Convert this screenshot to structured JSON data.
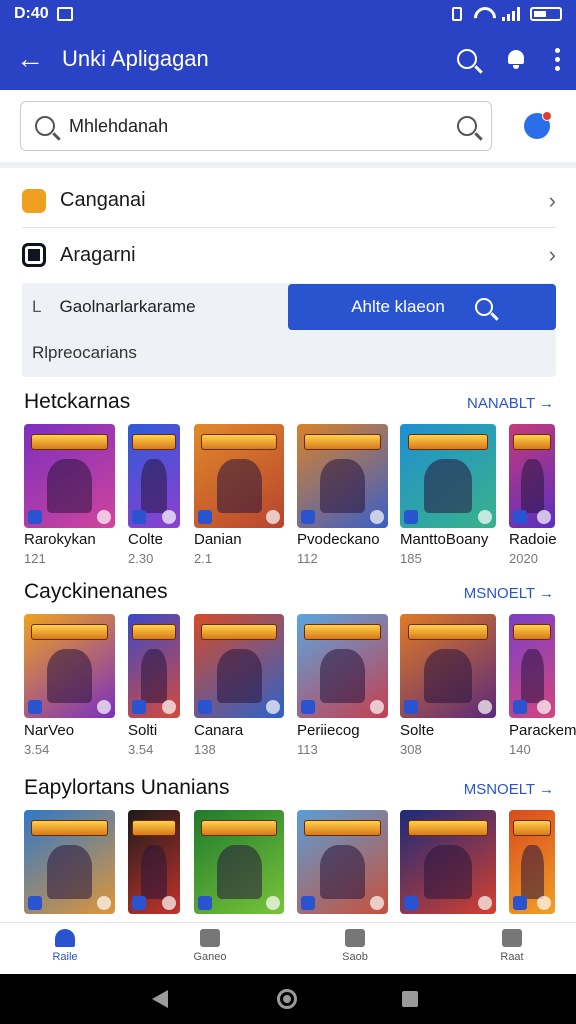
{
  "status_bar": {
    "time": "D:40",
    "indicator_icon": "square-icon"
  },
  "app_bar": {
    "title": "Unki Apligagan",
    "back_icon": "arrow-left-icon"
  },
  "search": {
    "value": "Mhlehdanah",
    "assistant_icon": "assistant-icon"
  },
  "menu": [
    {
      "label": "Canganai",
      "icon": "orange-app-icon"
    },
    {
      "label": "Aragarni",
      "icon": "dark-app-icon"
    }
  ],
  "filter": {
    "input_prefix": "L",
    "input_value": "Gaolnarlarkarame",
    "button_label": "Ahlte klaeon",
    "hint": "Rlpreocarians"
  },
  "sections": [
    {
      "title": "Hetckarnas",
      "more": "NANABLT →",
      "items": [
        {
          "name": "Rarokykan",
          "count": "121",
          "colors": [
            "#7a2fbf",
            "#d2449c"
          ]
        },
        {
          "name": "Colte",
          "count": "2.30",
          "colors": [
            "#2e5bd6",
            "#8e3fd0"
          ]
        },
        {
          "name": "Danian",
          "count": "2.1",
          "colors": [
            "#e08a2a",
            "#b8432e"
          ]
        },
        {
          "name": "Pvodeckano",
          "count": "112",
          "colors": [
            "#d9832a",
            "#3b5ec8"
          ]
        },
        {
          "name": "ManttoBoany",
          "count": "185",
          "colors": [
            "#1f8fd1",
            "#39b28a"
          ]
        },
        {
          "name": "Radoie",
          "count": "2020",
          "colors": [
            "#c53a7a",
            "#5a2fbf"
          ]
        }
      ]
    },
    {
      "title": "Cayckinenanes",
      "more": "MSNOELT →",
      "items": [
        {
          "name": "NarVeo",
          "count": "3.54",
          "colors": [
            "#f0a21e",
            "#7a2fbf"
          ]
        },
        {
          "name": "Solti",
          "count": "3.54",
          "colors": [
            "#3a49c8",
            "#d54a3a"
          ]
        },
        {
          "name": "Canara",
          "count": "138",
          "colors": [
            "#d74a28",
            "#2c62c9"
          ]
        },
        {
          "name": "Periiecog",
          "count": "113",
          "colors": [
            "#5aa6e0",
            "#c43f4f"
          ]
        },
        {
          "name": "Solte",
          "count": "308",
          "colors": [
            "#e07a25",
            "#5b2a7a"
          ]
        },
        {
          "name": "Parackem",
          "count": "140",
          "colors": [
            "#7b3fc6",
            "#d2467d"
          ]
        }
      ]
    },
    {
      "title": "Eapylortans Unanians",
      "more": "MSNOELT →",
      "items": [
        {
          "name": "",
          "count": "",
          "colors": [
            "#2f78c9",
            "#e09638"
          ]
        },
        {
          "name": "",
          "count": "",
          "colors": [
            "#1b1b1b",
            "#c4332b"
          ]
        },
        {
          "name": "",
          "count": "",
          "colors": [
            "#1f7a2c",
            "#79c43a"
          ]
        },
        {
          "name": "",
          "count": "",
          "colors": [
            "#5a9ed6",
            "#c8503a"
          ]
        },
        {
          "name": "",
          "count": "",
          "colors": [
            "#1b2a7a",
            "#d5402f"
          ]
        },
        {
          "name": "",
          "count": "",
          "colors": [
            "#d84a1e",
            "#f2a024"
          ]
        }
      ]
    }
  ],
  "bottom_nav": [
    {
      "label": "Raile",
      "icon": "home-icon",
      "active": true
    },
    {
      "label": "Ganeo",
      "icon": "store-icon",
      "active": false
    },
    {
      "label": "Saob",
      "icon": "book-icon",
      "active": false
    },
    {
      "label": "Raat",
      "icon": "person-icon",
      "active": false
    }
  ],
  "colors": {
    "brand": "#2a43c4",
    "accent": "#2a53d0"
  }
}
